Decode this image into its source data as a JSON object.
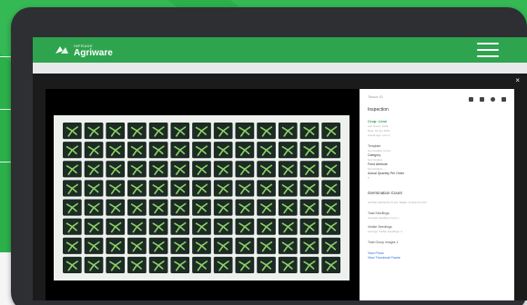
{
  "colors": {
    "brand_green": "#2ea44f",
    "promo_green": "#2bb04a",
    "link_blue": "#2b6fd6",
    "tablet_frame": "#2d2f33"
  },
  "app": {
    "logo_small": "INFRADE",
    "logo_big": "Agriware",
    "logo_icon": "leaf-logo-icon",
    "menu_icon": "hamburger-icon"
  },
  "modal": {
    "close_label": "×",
    "image_alt": "seedling-tray-photo",
    "tray": {
      "rows": 8,
      "cols": 13
    }
  },
  "details": {
    "title": "Tissue ID",
    "toolbar_icons": [
      "camera-icon",
      "download-icon",
      "refresh-icon",
      "delete-icon"
    ],
    "section_inspection": "Inspection",
    "crop": "Crop: Lime",
    "meta_lines": [
      "Lab Count: 1024",
      "Date: 01 Apr 2021",
      "Actual Age: Low 3"
    ],
    "fields": [
      {
        "label": "Template",
        "value": "Germination Count"
      },
      {
        "label": "Category",
        "value": "Germination"
      },
      {
        "label": "Feed Attribute",
        "value": "Germination  —"
      },
      {
        "label": "Actual Quantity Per Order",
        "value": "5"
      }
    ],
    "section_germination": "Germination Count",
    "germination_note": "AFTER GROWTH PLAN. WEEK 11 BAD PLANT",
    "seedling_lines": [
      {
        "label": "Total Seedlings",
        "value": "Average Seedling Count  —"
      },
      {
        "label": "Visible Seedlings",
        "value": "Average Visible Seedlings: 3"
      }
    ],
    "total_group": "Total Group Images 1",
    "links": [
      "View Photo",
      "View Thumbnail Frame"
    ]
  }
}
